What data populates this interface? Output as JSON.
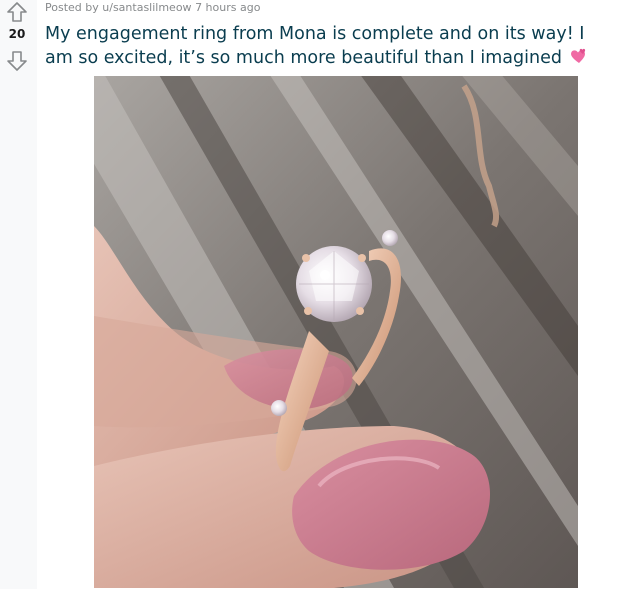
{
  "post": {
    "posted_by_prefix": "Posted by",
    "username": "u/santaslilmeow",
    "time_ago": "7 hours ago",
    "score": "20",
    "title": "My engagement ring from Mona is complete and on its way! I am so excited, it’s so much more beautiful than I imagined",
    "title_emoji": "two-hearts-emoji"
  },
  "icons": {
    "upvote": "upvote-arrow-icon",
    "downvote": "downvote-arrow-icon"
  },
  "colors": {
    "title": "#0a3d4f",
    "meta": "#878a8c",
    "vote_bg": "#f8f9fa"
  }
}
